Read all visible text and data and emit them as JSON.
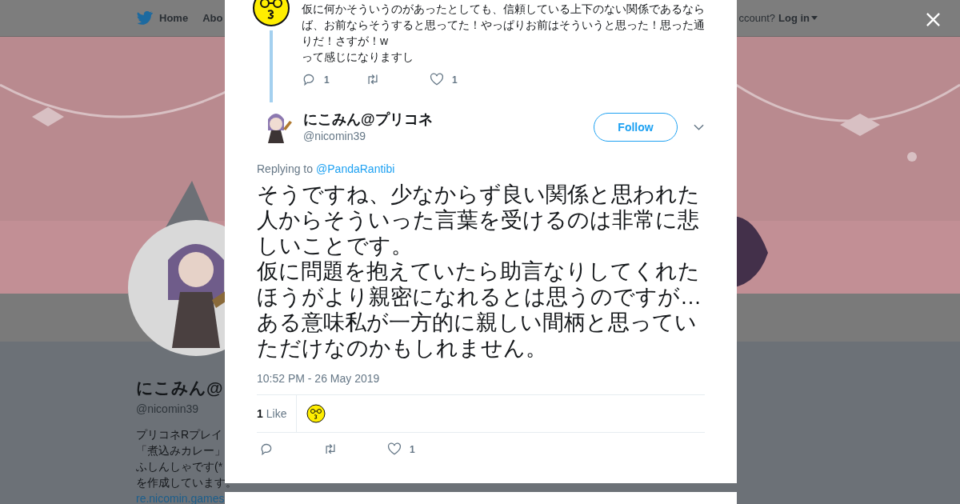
{
  "nav": {
    "items": [
      {
        "label": "Home"
      },
      {
        "label": "Abo"
      }
    ],
    "account_prompt": "ccount?",
    "login": "Log in"
  },
  "profile": {
    "name": "にこみん@",
    "handle": "@nicomin39",
    "bio_lines": [
      "プリコネRプレイ",
      "「煮込みカレー」",
      "ふしんしゃです(*",
      "を作成しています。"
    ],
    "website": "re.nicomin.games"
  },
  "modal": {
    "previous_tweet": {
      "text": "仮に何かそういうのがあったとしても、信頼している上下のない関係であるならば、お前ならそうすると思ってた！やっぱりお前はそういうと思った！思った通りだ！さすが！w\nって感じになりますし",
      "actions": [
        {
          "kind": "reply",
          "count": "1"
        },
        {
          "kind": "retweet"
        },
        {
          "kind": "like",
          "count": "1"
        }
      ]
    },
    "tweet": {
      "name": "にこみん@プリコネ",
      "handle": "@nicomin39",
      "follow": "Follow",
      "replying_label": "Replying to",
      "replying_to": "@PandaRantibi",
      "text_paragraphs": [
        "そうですね、少なからず良い関係と思われた人からそういった言葉を受けるのは非常に悲しいことです。",
        "仮に問題を抱えていたら助言なりしてくれたほうがより親密になれるとは思うのですが…ある意味私が一方的に親しい間柄と思っていただけなのかもしれません。"
      ],
      "timestamp": "10:52 PM - 26 May 2019",
      "likes_count": "1",
      "likes_label": "Like",
      "actions": [
        {
          "kind": "reply"
        },
        {
          "kind": "retweet"
        },
        {
          "kind": "like",
          "count": "1"
        }
      ]
    }
  }
}
